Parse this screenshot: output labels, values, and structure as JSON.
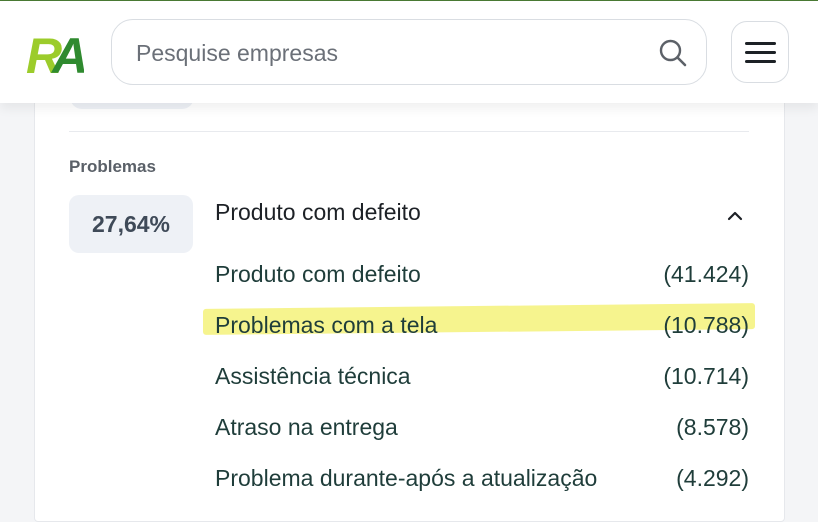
{
  "header": {
    "logo_text": "RA",
    "search_placeholder": "Pesquise empresas",
    "search_icon": "search-icon",
    "menu_icon": "hamburger-menu-icon"
  },
  "problems": {
    "section_label": "Problemas",
    "percentage": "27,64%",
    "selected": "Produto com defeito",
    "chevron_icon": "chevron-up-icon",
    "items": [
      {
        "label": "Produto com defeito",
        "count": "(41.424)"
      },
      {
        "label": "Problemas com a tela",
        "count": "(10.788)",
        "highlighted": true
      },
      {
        "label": "Assistência técnica",
        "count": "(10.714)"
      },
      {
        "label": "Atraso na entrega",
        "count": "(8.578)"
      },
      {
        "label": "Problema durante-após a atualização",
        "count": "(4.292)"
      }
    ]
  },
  "colors": {
    "brand_green": "#2f8a2f",
    "brand_lime": "#9ccc2b",
    "highlight": "#f5f27a",
    "item_text": "#1f3d3a"
  }
}
